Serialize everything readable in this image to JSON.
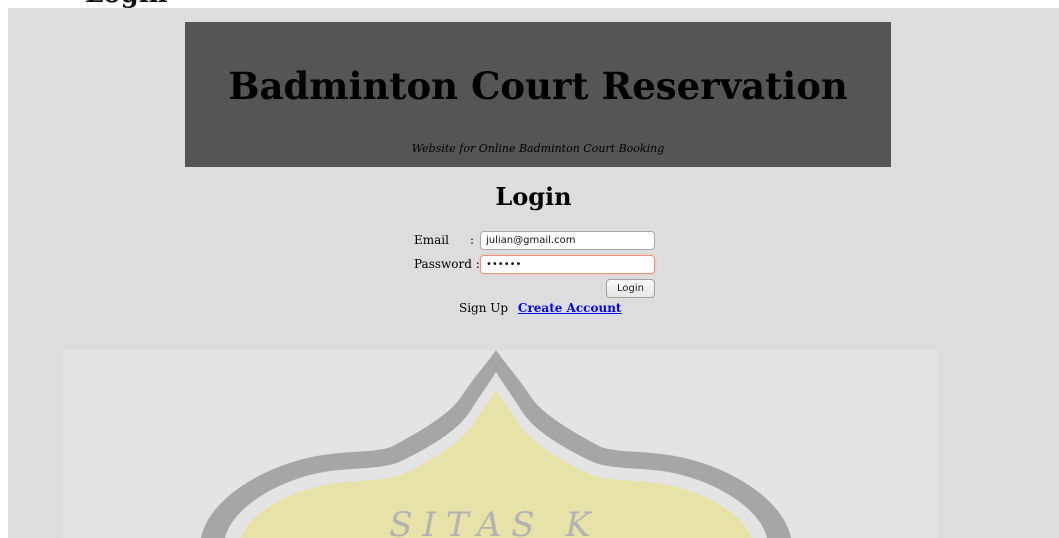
{
  "top_heading_fragment": "Login",
  "header": {
    "title": "Badminton Court Reservation",
    "subtitle": "Website for Online Badminton Court Booking"
  },
  "login": {
    "heading": "Login",
    "email_label": "Email",
    "email_sep": ":",
    "password_label": "Password :",
    "email_value": "julian@gmail.com",
    "password_value": "••••••",
    "login_button": "Login",
    "signup_text": "Sign Up",
    "create_account_link": "Create Account"
  },
  "watermark": {
    "text": "SITAS K",
    "icon": "university-seal-icon",
    "colors": {
      "outline": "#a6a6a6",
      "fill": "#e6e2a8"
    }
  },
  "colors": {
    "page_bg": "#dddddd",
    "banner_bg": "#555555",
    "link": "#0000ee",
    "focus_border": "#e8987a"
  }
}
